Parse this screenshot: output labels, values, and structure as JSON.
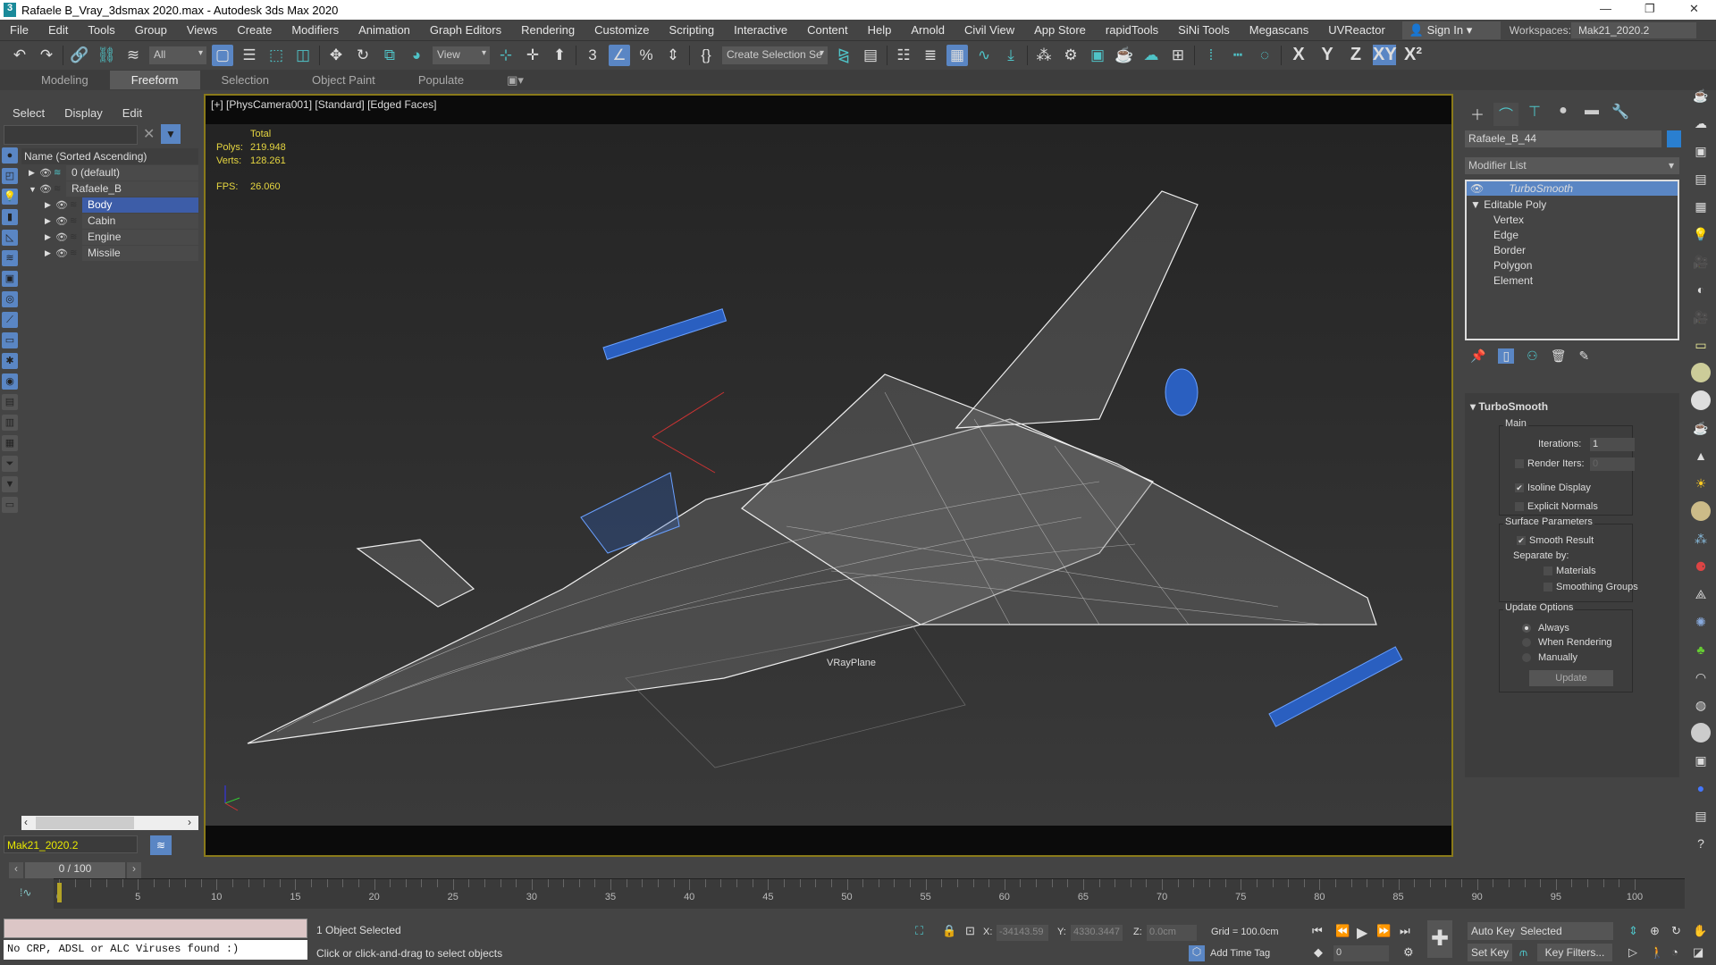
{
  "window": {
    "title": "Rafaele B_Vray_3dsmax 2020.max - Autodesk 3ds Max 2020",
    "logo": "3",
    "controls": [
      "minimize-icon",
      "restore-icon",
      "close-icon"
    ]
  },
  "menu": [
    "File",
    "Edit",
    "Tools",
    "Group",
    "Views",
    "Create",
    "Modifiers",
    "Animation",
    "Graph Editors",
    "Rendering",
    "Customize",
    "Scripting",
    "Interactive",
    "Content",
    "Help",
    "Arnold",
    "Civil View",
    "App Store",
    "rapidTools",
    "SiNi Tools",
    "Megascans",
    "UVReactor"
  ],
  "account": {
    "signin": "Sign In",
    "workspaces_label": "Workspaces:",
    "workspace": "Mak21_2020.2"
  },
  "toolbar": {
    "filter": "All",
    "refcoord": "View",
    "selection_set": "Create Selection Se",
    "axes": [
      "X",
      "Y",
      "Z",
      "XY",
      "X²"
    ]
  },
  "ribbon": [
    "Modeling",
    "Freeform",
    "Selection",
    "Object Paint",
    "Populate"
  ],
  "explorer": {
    "menu": [
      "Select",
      "Display",
      "Edit"
    ],
    "header": "Name (Sorted Ascending)",
    "rows": [
      {
        "name": "0 (default)",
        "level": 0,
        "expanded": false
      },
      {
        "name": "Rafaele_B",
        "level": 0,
        "expanded": true
      },
      {
        "name": "Body",
        "level": 1,
        "selected": true
      },
      {
        "name": "Cabin",
        "level": 1
      },
      {
        "name": "Engine",
        "level": 1
      },
      {
        "name": "Missile",
        "level": 1
      }
    ],
    "workspace": "Mak21_2020.2"
  },
  "viewport": {
    "label": "[+] [PhysCamera001] [Standard] [Edged Faces]",
    "stats": {
      "header": "Total",
      "polys_label": "Polys:",
      "polys": "219.948",
      "verts_label": "Verts:",
      "verts": "128.261",
      "fps_label": "FPS:",
      "fps": "26.060"
    },
    "object_label": "VRayPlane"
  },
  "command_panel": {
    "object_name": "Rafaele_B_44",
    "object_color": "#2a7fd0",
    "modifier_list": "Modifier List",
    "stack": [
      "TurboSmooth",
      "Editable Poly",
      "Vertex",
      "Edge",
      "Border",
      "Polygon",
      "Element"
    ],
    "rollout": {
      "title": "TurboSmooth",
      "main": "Main",
      "iterations_label": "Iterations:",
      "iterations": "1",
      "render_iters_label": "Render Iters:",
      "render_iters": "0",
      "isoline": "Isoline Display",
      "explicit": "Explicit Normals",
      "surface": "Surface Parameters",
      "smooth_result": "Smooth Result",
      "separate_by": "Separate by:",
      "materials": "Materials",
      "smoothing_groups": "Smoothing Groups",
      "update_options": "Update Options",
      "always": "Always",
      "when_rendering": "When Rendering",
      "manually": "Manually",
      "update": "Update"
    }
  },
  "timeline": {
    "slider": "0 / 100",
    "current": 0,
    "end": 100,
    "labels": [
      "0",
      "5",
      "10",
      "15",
      "20",
      "25",
      "30",
      "35",
      "40",
      "45",
      "50",
      "55",
      "60",
      "65",
      "70",
      "75",
      "80",
      "85",
      "90",
      "95",
      "100"
    ]
  },
  "status": {
    "maxscript": "",
    "listener": "No CRP, ADSL or ALC Viruses found :)",
    "selected": "1 Object Selected",
    "prompt": "Click or click-and-drag to select objects",
    "x_label": "X:",
    "x": "-34143.59",
    "y_label": "Y:",
    "y": "4330.3447",
    "z_label": "Z:",
    "z": "0.0cm",
    "grid": "Grid = 100.0cm",
    "add_time_tag": "Add Time Tag",
    "frame": "0",
    "auto_key": "Auto Key",
    "set_key": "Set Key",
    "key_mode": "Selected",
    "key_filters": "Key Filters..."
  }
}
